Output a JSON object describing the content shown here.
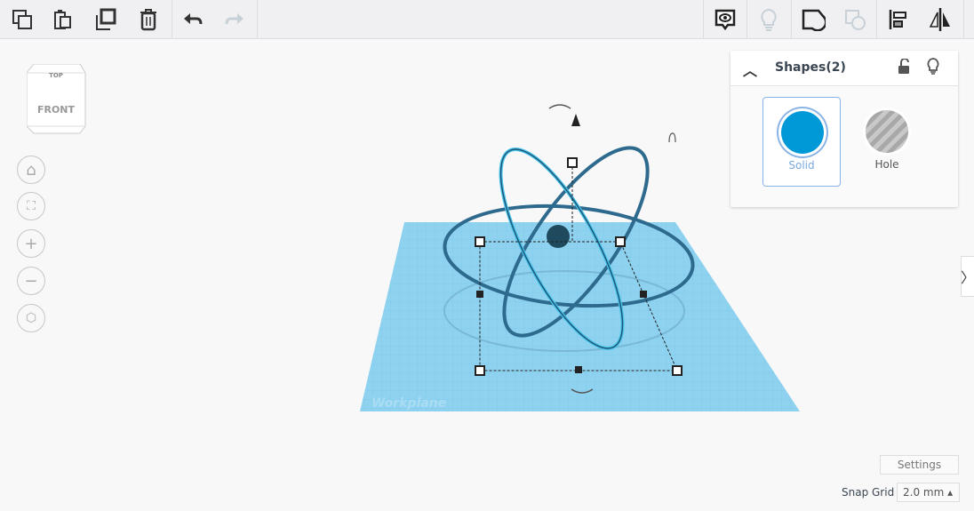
{
  "toolbar": {
    "left": [
      "copy-icon",
      "paste-icon",
      "duplicate-icon",
      "delete-icon",
      "undo-icon",
      "redo-icon"
    ],
    "right": [
      "notes-icon",
      "light-icon",
      "group-icon",
      "ungroup-icon",
      "align-icon",
      "mirror-icon"
    ]
  },
  "viewcube": {
    "top": "TOP",
    "front": "FRONT"
  },
  "nav": [
    "home-icon",
    "fit-icon",
    "zoom-in-icon",
    "zoom-out-icon",
    "perspective-icon"
  ],
  "panel": {
    "title": "Shapes(2)",
    "solid": "Solid",
    "hole": "Hole",
    "solid_color": "#0099d8"
  },
  "workplane": {
    "label": "Workplane"
  },
  "footer": {
    "settings": "Settings",
    "snap_label": "Snap Grid",
    "snap_value": "2.0 mm ▴"
  }
}
